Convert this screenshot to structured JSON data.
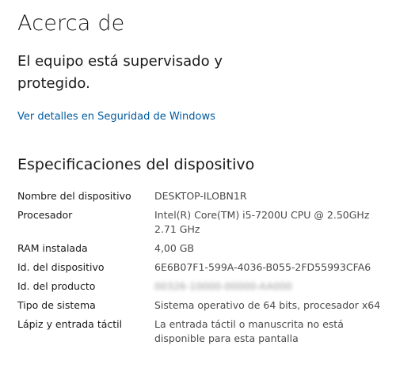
{
  "page": {
    "title": "Acerca de"
  },
  "protection": {
    "status": "El equipo está supervisado y protegido.",
    "link": "Ver detalles en Seguridad de Windows"
  },
  "device_specs": {
    "heading": "Especificaciones del dispositivo",
    "rows": [
      {
        "label": "Nombre del dispositivo",
        "value": "DESKTOP-ILOBN1R"
      },
      {
        "label": "Procesador",
        "value": "Intel(R) Core(TM) i5-7200U CPU @ 2.50GHz 2.71 GHz"
      },
      {
        "label": "RAM instalada",
        "value": "4,00 GB"
      },
      {
        "label": "Id. del dispositivo",
        "value": "6E6B07F1-599A-4036-B055-2FD55993CFA6"
      },
      {
        "label": "Id. del producto",
        "value": "00326-10000-00000-AA000"
      },
      {
        "label": "Tipo de sistema",
        "value": "Sistema operativo de 64 bits, procesador x64"
      },
      {
        "label": "Lápiz y entrada táctil",
        "value": "La entrada táctil o manuscrita no está disponible para esta pantalla"
      }
    ]
  }
}
